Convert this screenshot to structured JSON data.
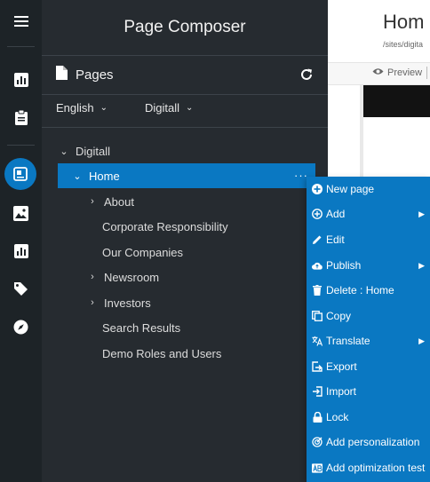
{
  "panel": {
    "title": "Page Composer",
    "pages_label": "Pages",
    "language": "English",
    "site": "Digitall"
  },
  "tree": {
    "root": "Digitall",
    "selected": "Home",
    "selected_more": "···",
    "children": [
      {
        "label": "About",
        "expandable": true
      },
      {
        "label": "Corporate Responsibility",
        "expandable": false
      },
      {
        "label": "Our Companies",
        "expandable": false
      },
      {
        "label": "Newsroom",
        "expandable": true
      },
      {
        "label": "Investors",
        "expandable": true
      },
      {
        "label": "Search Results",
        "expandable": false
      },
      {
        "label": "Demo Roles and Users",
        "expandable": false
      }
    ]
  },
  "menu": {
    "items": [
      {
        "label": "New page",
        "icon": "plus-circle-icon",
        "submenu": false
      },
      {
        "label": "Add",
        "icon": "add-circle-outline-icon",
        "submenu": true
      },
      {
        "label": "Edit",
        "icon": "pencil-icon",
        "submenu": false
      },
      {
        "label": "Publish",
        "icon": "cloud-upload-icon",
        "submenu": true
      },
      {
        "label": "Delete : Home",
        "icon": "trash-icon",
        "submenu": false
      },
      {
        "label": "Copy",
        "icon": "copy-icon",
        "submenu": false
      },
      {
        "label": "Translate",
        "icon": "translate-icon",
        "submenu": true
      },
      {
        "label": "Export",
        "icon": "export-icon",
        "submenu": false
      },
      {
        "label": "Import",
        "icon": "import-icon",
        "submenu": false
      },
      {
        "label": "Lock",
        "icon": "lock-icon",
        "submenu": false
      },
      {
        "label": "Add personalization",
        "icon": "target-icon",
        "submenu": false
      },
      {
        "label": "Add optimization test",
        "icon": "ab-test-icon",
        "submenu": false
      }
    ]
  },
  "content": {
    "title": "Hom",
    "path": "/sites/digita",
    "preview_label": "Preview"
  },
  "colors": {
    "rail_bg": "#1d2327",
    "panel_bg": "#262b30",
    "accent": "#0a78c2"
  }
}
